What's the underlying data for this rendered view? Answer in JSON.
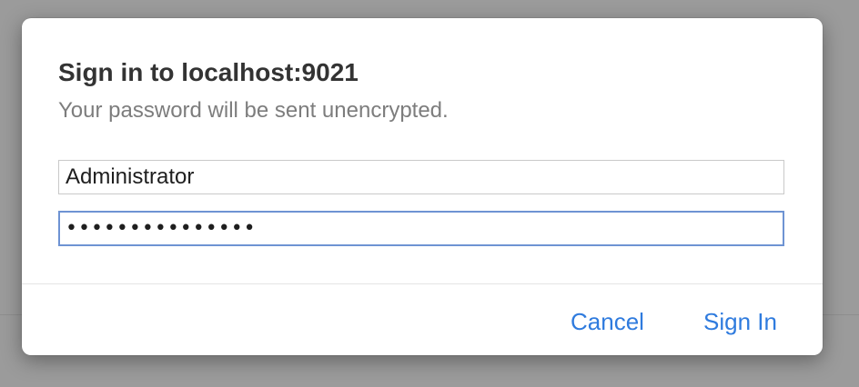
{
  "dialog": {
    "title": "Sign in to localhost:9021",
    "subtitle": "Your password will be sent unencrypted.",
    "username_value": "Administrator",
    "password_value": "•••••••••••••••",
    "cancel_label": "Cancel",
    "signin_label": "Sign In"
  },
  "colors": {
    "accent": "#2f7bde",
    "focus_ring": "#6e93d3",
    "backdrop": "#9b9b9b"
  }
}
